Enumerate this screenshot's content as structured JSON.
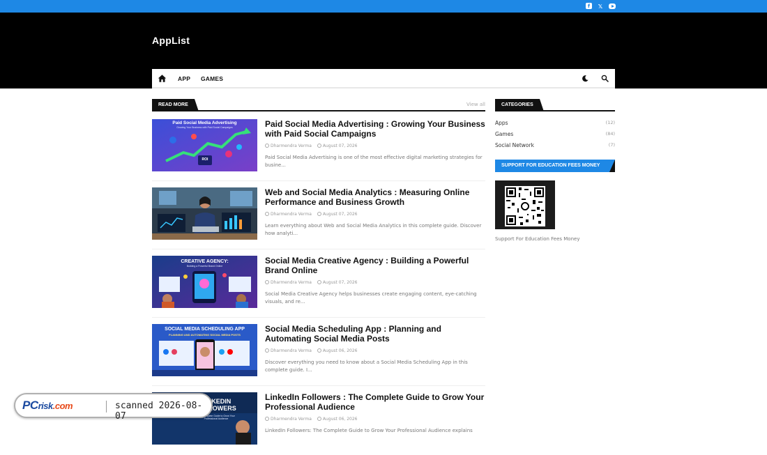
{
  "site": {
    "name": "AppList"
  },
  "social": {
    "facebook_icon": "facebook-icon",
    "x_icon": "x-icon",
    "youtube_icon": "youtube-icon",
    "x_glyph": "𝕏"
  },
  "nav": {
    "items": [
      "APP",
      "GAMES"
    ],
    "home_icon": "home-icon",
    "theme_icon": "moon-icon",
    "search_icon": "search-icon"
  },
  "read_more": {
    "heading": "READ MORE",
    "view_all": "View all"
  },
  "posts": [
    {
      "title": "Paid Social Media Advertising : Growing Your Business with Paid Social Campaigns",
      "author": "Dharmendra Verma",
      "date": "August 07, 2026",
      "excerpt": "Paid Social Media Advertising is one of the most effective digital marketing strategies for busine...",
      "thumb_text": "Paid Social Media Advertising",
      "thumb_sub": "Growing Your Business with Paid Social Campaigns",
      "thumb_badge": "ROI"
    },
    {
      "title": "Web and Social Media Analytics : Measuring Online Performance and Business Growth",
      "author": "Dharmendra Verma",
      "date": "August 07, 2026",
      "excerpt": "Learn everything about Web and Social Media Analytics in this complete guide. Discover how analyti..."
    },
    {
      "title": "Social Media Creative Agency : Building a Powerful Brand Online",
      "author": "Dharmendra Verma",
      "date": "August 07, 2026",
      "excerpt": "Social Media Creative Agency helps businesses create engaging content, eye-catching visuals, and re...",
      "thumb_text": "CREATIVE AGENCY:",
      "thumb_sub": "Building a Powerful Brand Online"
    },
    {
      "title": "Social Media Scheduling App : Planning and Automating Social Media Posts",
      "author": "Dharmendra Verma",
      "date": "August 06, 2026",
      "excerpt": "Discover everything you need to know about a Social Media Scheduling App in this complete guide. I...",
      "thumb_text": "SOCIAL MEDIA SCHEDULING APP",
      "thumb_sub": "PLANNING AND AUTOMATING SOCIAL MEDIA POSTS"
    },
    {
      "title": "LinkedIn Followers : The Complete Guide to Grow Your Professional Audience",
      "author": "Dharmendra Verma",
      "date": "August 06, 2026",
      "excerpt": "LinkedIn Followers: The Complete Guide to Grow Your Professional Audience explains",
      "thumb_text": "LINKEDIN FOLLOWERS",
      "thumb_sub": "The Complete Guide to Grow Your Professional Audience"
    }
  ],
  "categories": {
    "heading": "CATEGORIES",
    "items": [
      {
        "name": "Apps",
        "count": "(12)"
      },
      {
        "name": "Games",
        "count": "(84)"
      },
      {
        "name": "Social Network",
        "count": "(7)"
      }
    ]
  },
  "support": {
    "heading": "SUPPORT FOR EDUCATION FEES MONEY",
    "caption": "Support For Education Fees Money"
  },
  "watermark": {
    "logo_pc": "PC",
    "logo_risk": "risk",
    "logo_dot": ".com",
    "text": "scanned 2026-08-07"
  },
  "colors": {
    "accent": "#1e88e5",
    "header_bg": "#000000",
    "text_dark": "#111111"
  }
}
